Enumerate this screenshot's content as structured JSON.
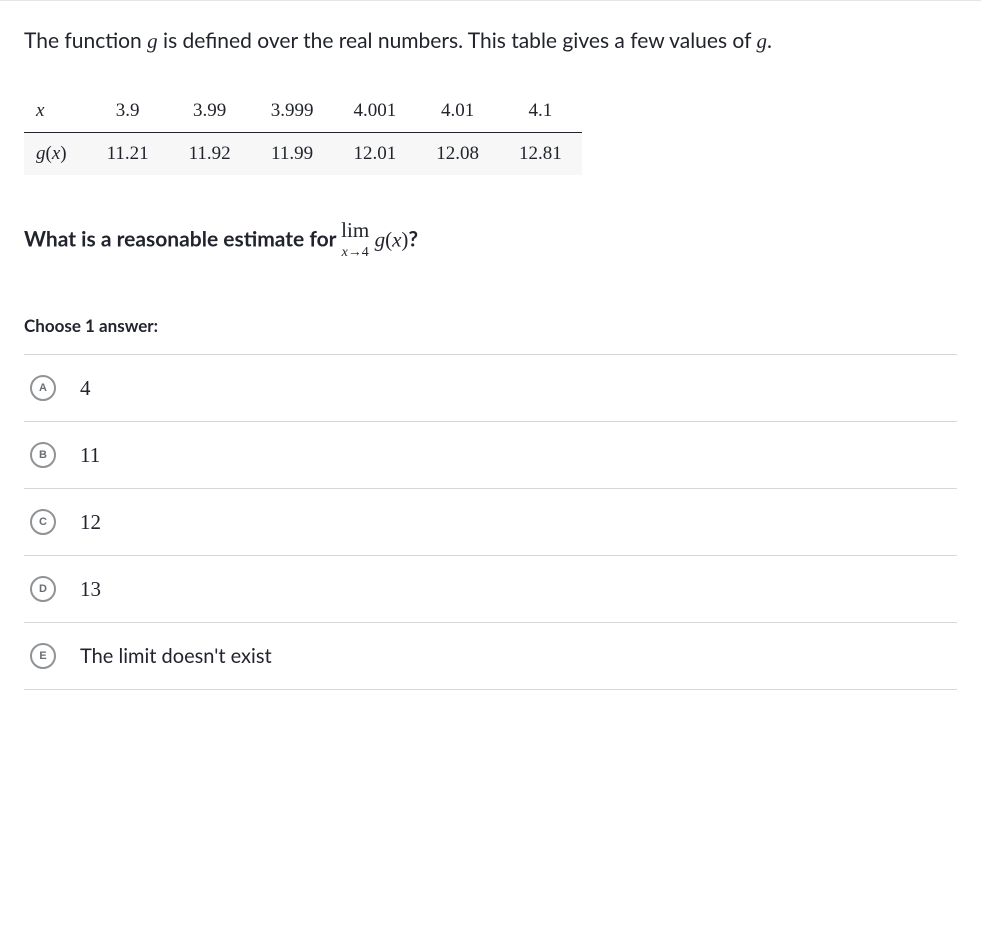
{
  "intro": {
    "part1": "The function ",
    "fn": "g",
    "part2": " is defined over the real numbers. This table gives a few values of ",
    "fn2": "g",
    "part3": "."
  },
  "table": {
    "rowLabels": [
      "x",
      "g(x)"
    ],
    "xs": [
      "3.9",
      "3.99",
      "3.999",
      "4.001",
      "4.01",
      "4.1"
    ],
    "gs": [
      "11.21",
      "11.92",
      "11.99",
      "12.01",
      "12.08",
      "12.81"
    ]
  },
  "question": {
    "prefix": "What is a reasonable estimate for ",
    "lim": "lim",
    "sub": "x→4",
    "gx": "g(x)",
    "suffix": "?"
  },
  "choose": "Choose 1 answer:",
  "answers": [
    {
      "letter": "A",
      "text": "4",
      "plain": false
    },
    {
      "letter": "B",
      "text": "11",
      "plain": false
    },
    {
      "letter": "C",
      "text": "12",
      "plain": false
    },
    {
      "letter": "D",
      "text": "13",
      "plain": false
    },
    {
      "letter": "E",
      "text": "The limit doesn't exist",
      "plain": true
    }
  ]
}
